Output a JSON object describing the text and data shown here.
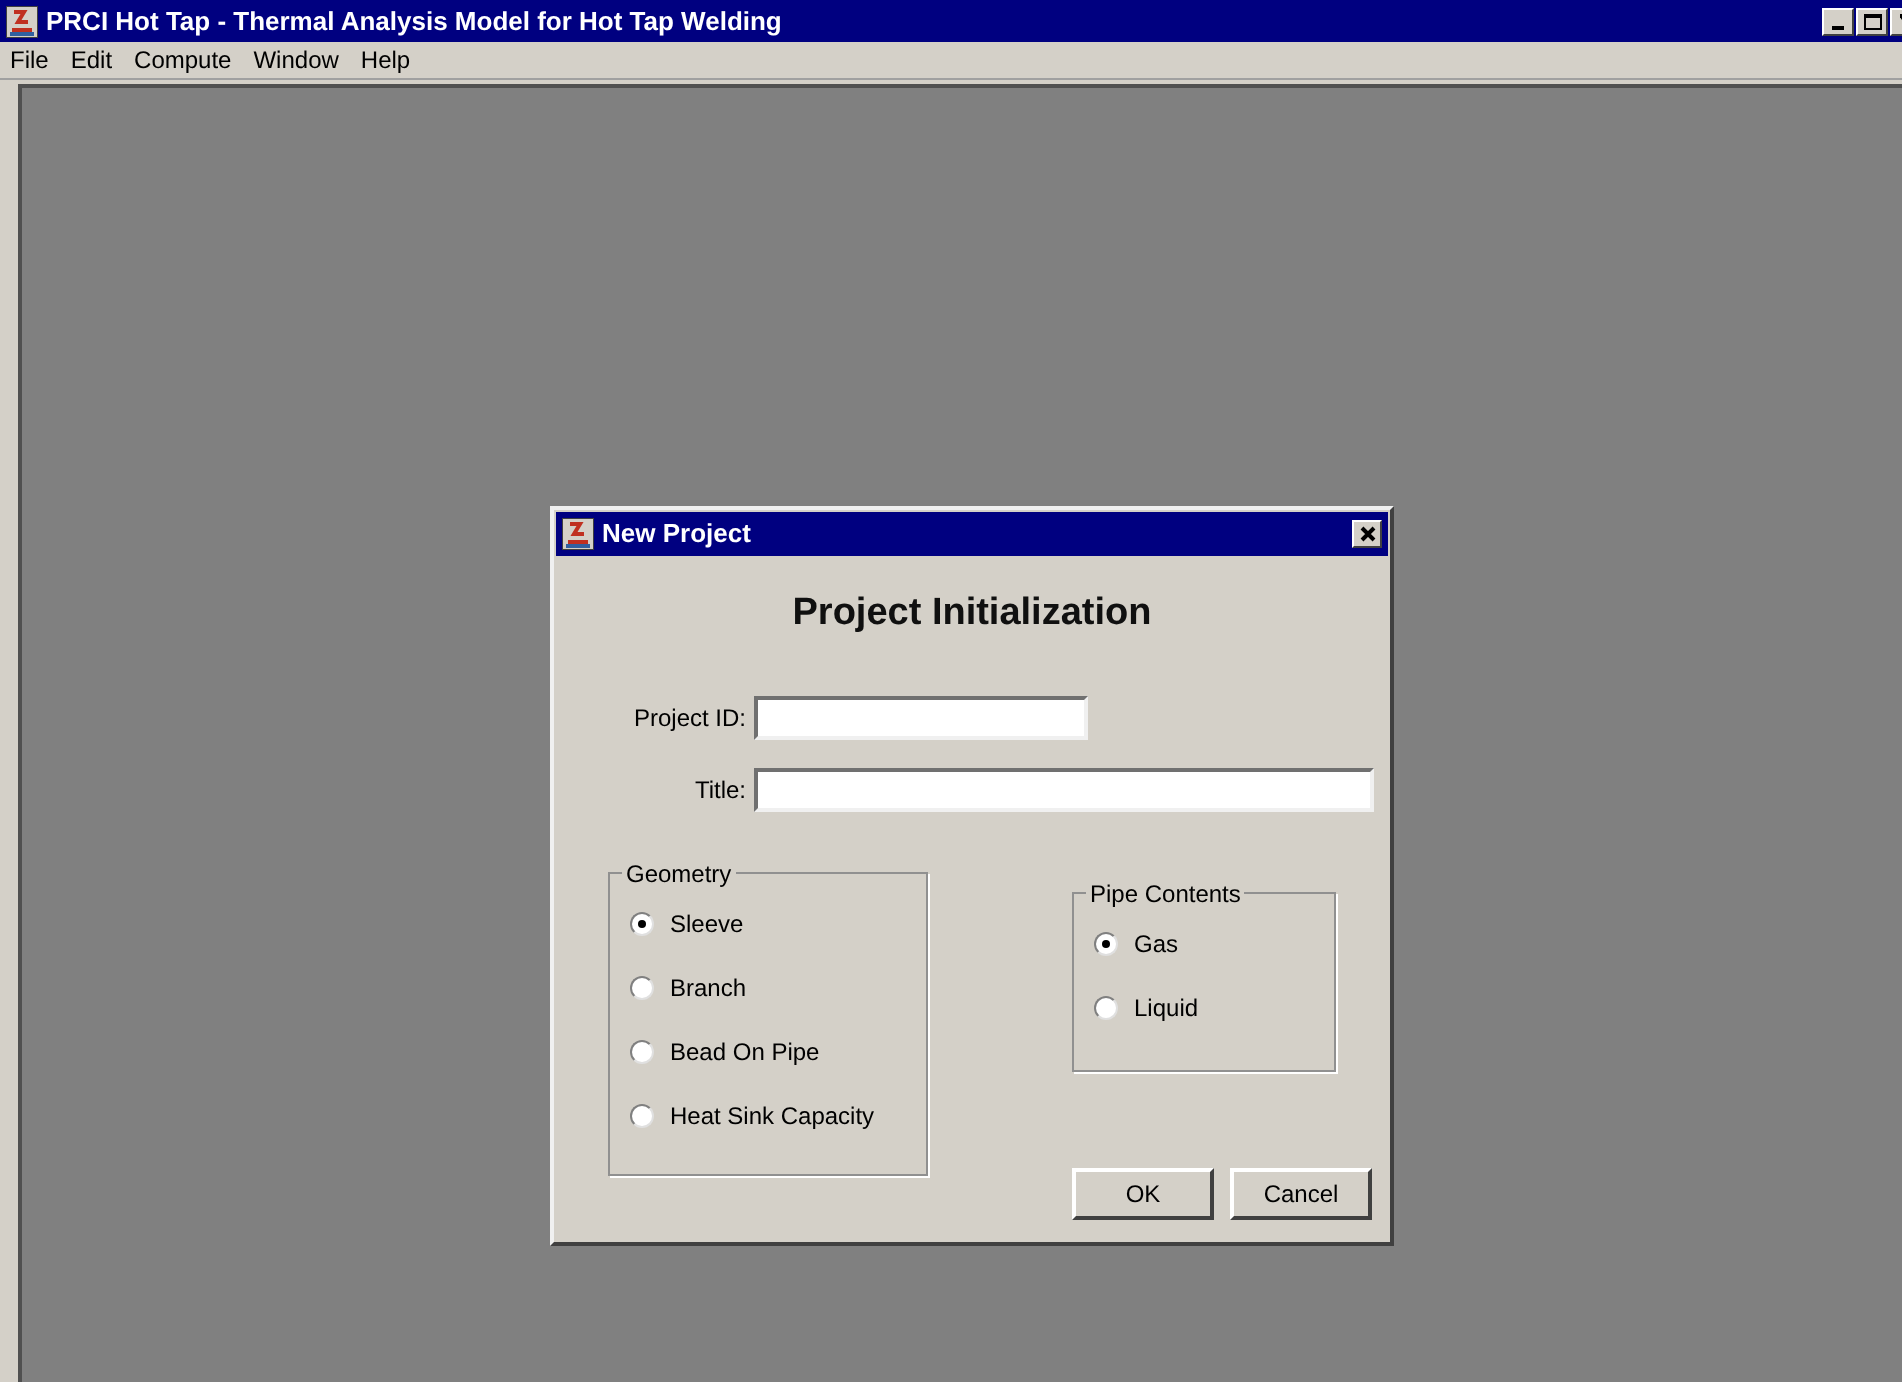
{
  "window": {
    "title": "PRCI Hot Tap - Thermal Analysis Model for Hot Tap Welding"
  },
  "menu": [
    "File",
    "Edit",
    "Compute",
    "Window",
    "Help"
  ],
  "dialog": {
    "title": "New Project",
    "heading": "Project Initialization",
    "fields": [
      {
        "label": "Project ID:"
      },
      {
        "label": "Title:"
      }
    ],
    "geometry": {
      "label": "Geometry",
      "options": [
        {
          "label": "Sleeve",
          "selected": true
        },
        {
          "label": "Branch",
          "selected": false
        },
        {
          "label": "Bead On Pipe",
          "selected": false
        },
        {
          "label": "Heat Sink Capacity",
          "selected": false
        }
      ]
    },
    "pipe_contents": {
      "label": "Pipe Contents",
      "options": [
        {
          "label": "Gas",
          "selected": true
        },
        {
          "label": "Liquid",
          "selected": false
        }
      ]
    },
    "buttons": [
      "OK",
      "Cancel"
    ]
  }
}
